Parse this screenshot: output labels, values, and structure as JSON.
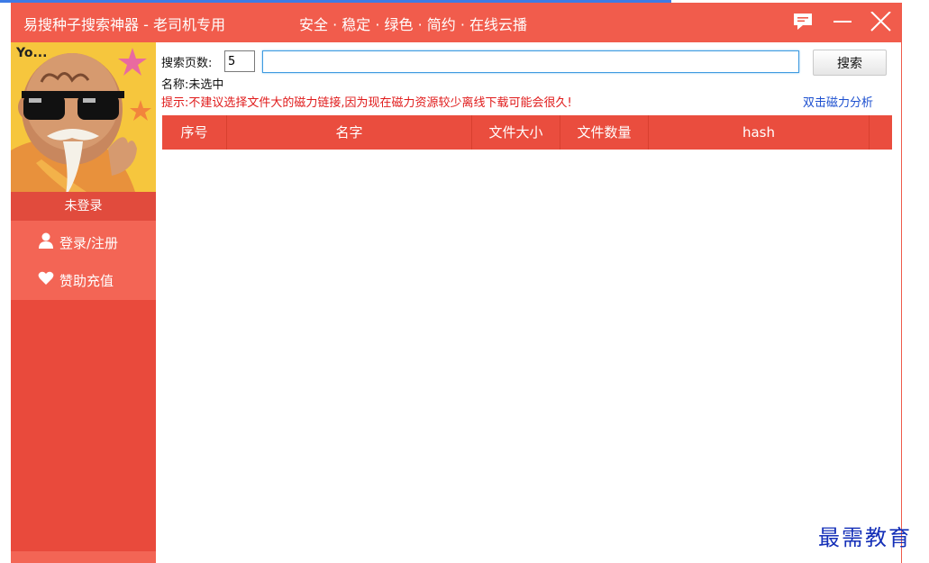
{
  "window": {
    "app_title": "易搜种子搜索神器 - 老司机专用",
    "tagline": "安全 · 稳定 · 绿色 · 简约 · 在线云播",
    "accent_color": "#f15c4c",
    "buttons": {
      "feedback_icon": "chat-bubble-icon",
      "minimize_icon": "minimize-icon",
      "close_icon": "close-icon"
    }
  },
  "sidebar": {
    "avatar_text": "Yo...",
    "login_status": "未登录",
    "items": [
      {
        "icon": "user-icon",
        "label": "登录/注册"
      },
      {
        "icon": "heart-icon",
        "label": "赞助充值"
      }
    ]
  },
  "search": {
    "pages_label": "搜索页数:",
    "pages_value": "5",
    "query_value": "",
    "button_label": "搜索"
  },
  "info": {
    "name_line": "名称:未选中",
    "hint": "提示:不建议选择文件大的磁力链接,因为现在磁力资源较少离线下载可能会很久!",
    "magnet_link": "双击磁力分析"
  },
  "table": {
    "columns": [
      "序号",
      "名字",
      "文件大小",
      "文件数量",
      "hash"
    ],
    "rows": []
  },
  "watermark": "最需教育"
}
